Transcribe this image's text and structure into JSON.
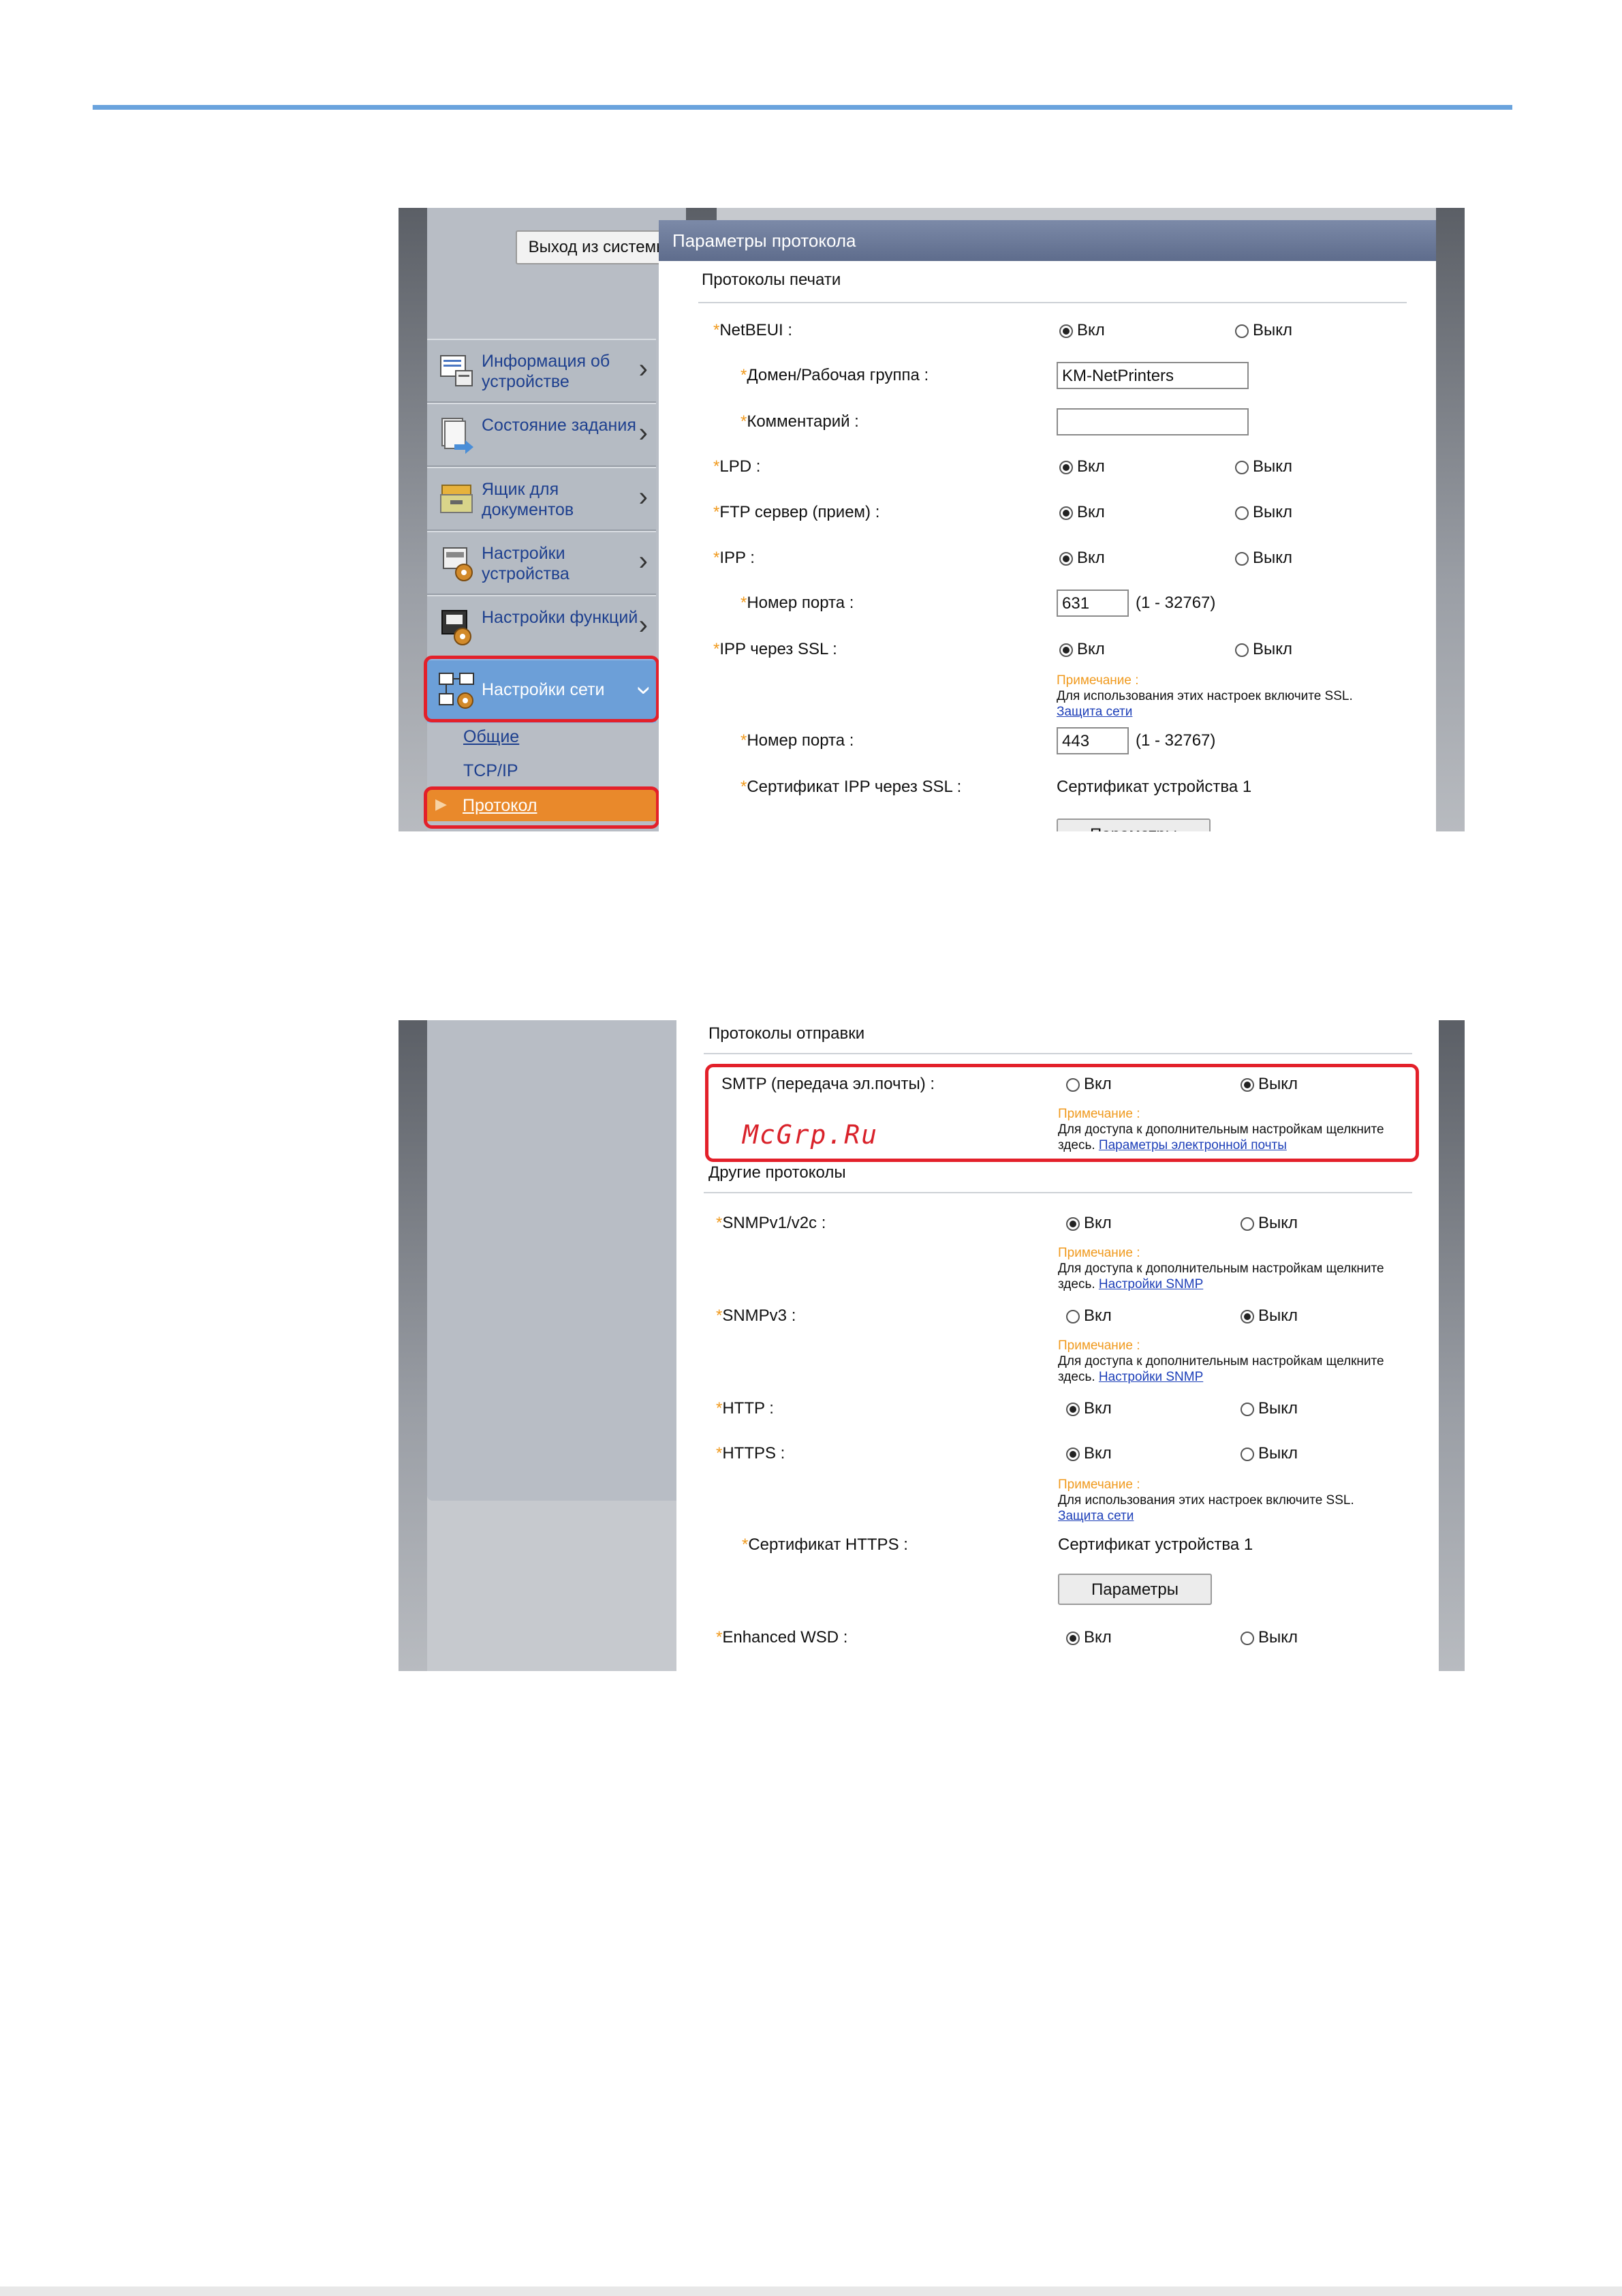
{
  "screen1": {
    "logout_label": "Выход из системы",
    "menu": [
      {
        "label": "Информация об устройстве",
        "icon": "device-info-icon"
      },
      {
        "label": "Состояние задания",
        "icon": "job-status-icon"
      },
      {
        "label": "Ящик для документов",
        "icon": "document-box-icon"
      },
      {
        "label": "Настройки устройства",
        "icon": "device-settings-icon"
      },
      {
        "label": "Настройки функций",
        "icon": "function-settings-icon"
      },
      {
        "label": "Настройки сети",
        "icon": "network-settings-icon"
      }
    ],
    "submenu": {
      "general": "Общие",
      "tcpip": "TCP/IP",
      "protocol": "Протокол"
    },
    "panel_title": "Параметры протокола",
    "section_print": "Протоколы печати",
    "on_label": "Вкл",
    "off_label": "Выкл",
    "rows": {
      "netbeui": "NetBEUI :",
      "domain": "Домен/Рабочая группа :",
      "domain_value": "KM-NetPrinters",
      "comment": "Комментарий :",
      "comment_value": "",
      "lpd": "LPD :",
      "ftp": "FTP сервер (прием) :",
      "ipp": "IPP :",
      "port": "Номер порта :",
      "ipp_port_value": "631",
      "port_range": "(1 - 32767)",
      "ipp_ssl": "IPP через SSL :",
      "ipp_ssl_port_value": "443",
      "ipp_ssl_cert": "Сертификат IPP через SSL :",
      "cert_value": "Сертификат устройства 1",
      "params_button": "Параметры"
    },
    "note_head": "Примечание :",
    "note_ssl_text": "Для использования этих настроек включите SSL.",
    "note_ssl_link": "Защита сети"
  },
  "screen2": {
    "section_send": "Протоколы отправки",
    "smtp": "SMTP (передача эл.почты) :",
    "note_head": "Примечание :",
    "note_more_text": "Для доступа к дополнительным настройкам щелкните здесь.",
    "smtp_link": "Параметры электронной почты",
    "watermark": "McGrp.Ru",
    "section_other": "Другие протоколы",
    "snmpv1": "SNMPv1/v2c :",
    "snmp_link": "Настройки SNMP",
    "snmpv3": "SNMPv3 :",
    "http": "HTTP :",
    "https": "HTTPS :",
    "note_ssl_text": "Для использования этих настроек включите SSL.",
    "note_ssl_link": "Защита сети",
    "https_cert": "Сертификат HTTPS :",
    "cert_value": "Сертификат устройства 1",
    "params_button": "Параметры",
    "wsd": "Enhanced WSD :",
    "on_label": "Вкл",
    "off_label": "Выкл"
  },
  "colors": {
    "accent_line": "#6aa3dd",
    "highlight": "#e3202a",
    "active_menu": "#6c9fd8",
    "active_sub": "#e9892b",
    "note": "#f09a1e"
  }
}
